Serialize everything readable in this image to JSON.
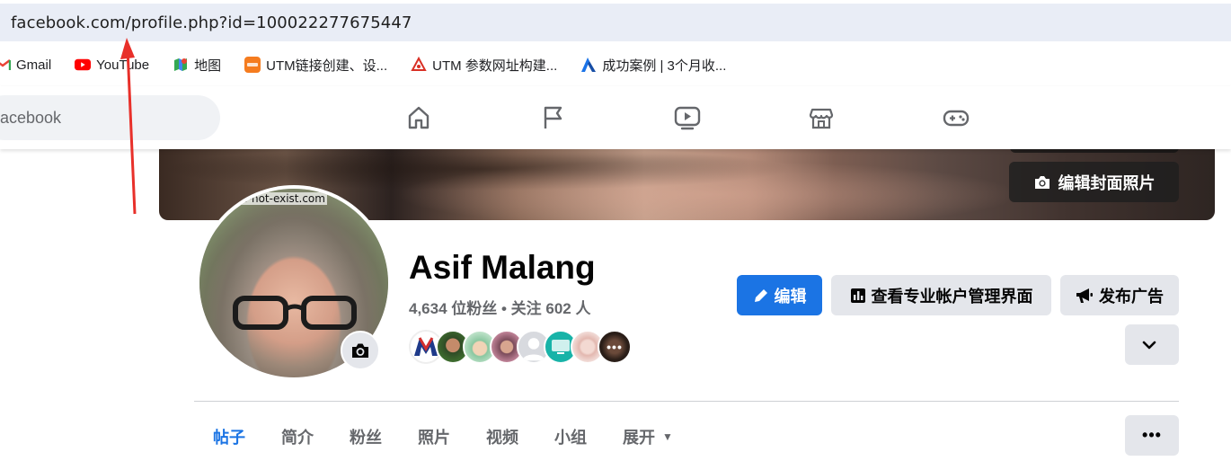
{
  "browser": {
    "url": "facebook.com/profile.php?id=100022277675447",
    "bookmarks": [
      {
        "label": "Gmail",
        "icon": "gmail-icon"
      },
      {
        "label": "YouTube",
        "icon": "youtube-icon"
      },
      {
        "label": "地图",
        "icon": "maps-icon"
      },
      {
        "label": "UTM链接创建、设...",
        "icon": "utm-icon"
      },
      {
        "label": "UTM 参数网址构建...",
        "icon": "utm-builder-icon"
      },
      {
        "label": "成功案例 | 3个月收...",
        "icon": "success-case-icon"
      }
    ]
  },
  "header": {
    "search_placeholder": "acebook",
    "nav_icons": [
      "home-icon",
      "pages-flag-icon",
      "watch-icon",
      "marketplace-icon",
      "gaming-icon"
    ]
  },
  "cover": {
    "edit_cover_label": "编辑封面照片"
  },
  "profile": {
    "avatar_watermark": "es-not-exist.com",
    "name": "Asif Malang",
    "stats": "4,634 位粉丝 • 关注 602 人",
    "friend_avatar_count": 8
  },
  "actions": {
    "edit_label": "编辑",
    "pro_dashboard_label": "查看专业帐户管理界面",
    "advertise_label": "发布广告"
  },
  "tabs": [
    {
      "label": "帖子",
      "active": true
    },
    {
      "label": "简介",
      "active": false
    },
    {
      "label": "粉丝",
      "active": false
    },
    {
      "label": "照片",
      "active": false
    },
    {
      "label": "视频",
      "active": false
    },
    {
      "label": "小组",
      "active": false
    },
    {
      "label": "展开",
      "active": false
    }
  ],
  "colors": {
    "accent": "#1b74e4",
    "annotation_arrow": "#e8302a"
  }
}
